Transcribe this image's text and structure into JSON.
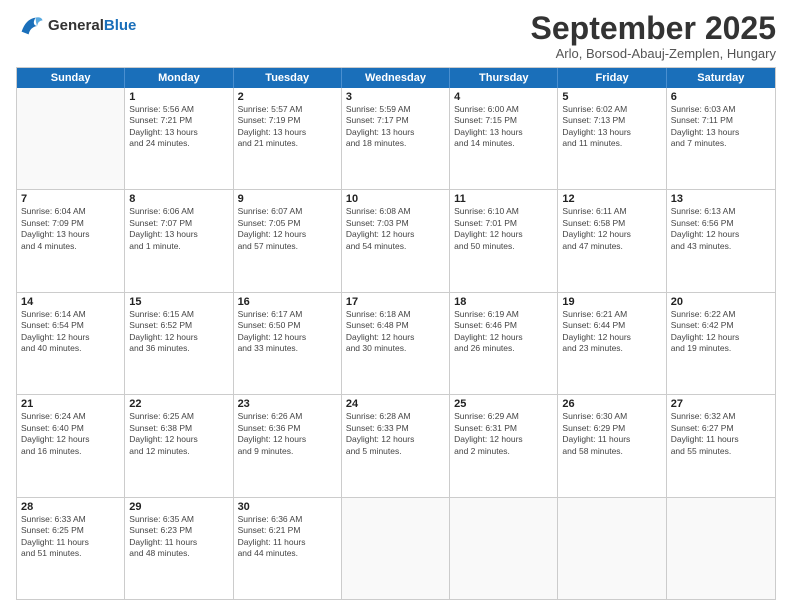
{
  "header": {
    "logo_line1": "General",
    "logo_line2": "Blue",
    "month": "September 2025",
    "location": "Arlo, Borsod-Abauj-Zemplen, Hungary"
  },
  "days_of_week": [
    "Sunday",
    "Monday",
    "Tuesday",
    "Wednesday",
    "Thursday",
    "Friday",
    "Saturday"
  ],
  "weeks": [
    [
      {
        "day": "",
        "info": ""
      },
      {
        "day": "1",
        "info": "Sunrise: 5:56 AM\nSunset: 7:21 PM\nDaylight: 13 hours\nand 24 minutes."
      },
      {
        "day": "2",
        "info": "Sunrise: 5:57 AM\nSunset: 7:19 PM\nDaylight: 13 hours\nand 21 minutes."
      },
      {
        "day": "3",
        "info": "Sunrise: 5:59 AM\nSunset: 7:17 PM\nDaylight: 13 hours\nand 18 minutes."
      },
      {
        "day": "4",
        "info": "Sunrise: 6:00 AM\nSunset: 7:15 PM\nDaylight: 13 hours\nand 14 minutes."
      },
      {
        "day": "5",
        "info": "Sunrise: 6:02 AM\nSunset: 7:13 PM\nDaylight: 13 hours\nand 11 minutes."
      },
      {
        "day": "6",
        "info": "Sunrise: 6:03 AM\nSunset: 7:11 PM\nDaylight: 13 hours\nand 7 minutes."
      }
    ],
    [
      {
        "day": "7",
        "info": "Sunrise: 6:04 AM\nSunset: 7:09 PM\nDaylight: 13 hours\nand 4 minutes."
      },
      {
        "day": "8",
        "info": "Sunrise: 6:06 AM\nSunset: 7:07 PM\nDaylight: 13 hours\nand 1 minute."
      },
      {
        "day": "9",
        "info": "Sunrise: 6:07 AM\nSunset: 7:05 PM\nDaylight: 12 hours\nand 57 minutes."
      },
      {
        "day": "10",
        "info": "Sunrise: 6:08 AM\nSunset: 7:03 PM\nDaylight: 12 hours\nand 54 minutes."
      },
      {
        "day": "11",
        "info": "Sunrise: 6:10 AM\nSunset: 7:01 PM\nDaylight: 12 hours\nand 50 minutes."
      },
      {
        "day": "12",
        "info": "Sunrise: 6:11 AM\nSunset: 6:58 PM\nDaylight: 12 hours\nand 47 minutes."
      },
      {
        "day": "13",
        "info": "Sunrise: 6:13 AM\nSunset: 6:56 PM\nDaylight: 12 hours\nand 43 minutes."
      }
    ],
    [
      {
        "day": "14",
        "info": "Sunrise: 6:14 AM\nSunset: 6:54 PM\nDaylight: 12 hours\nand 40 minutes."
      },
      {
        "day": "15",
        "info": "Sunrise: 6:15 AM\nSunset: 6:52 PM\nDaylight: 12 hours\nand 36 minutes."
      },
      {
        "day": "16",
        "info": "Sunrise: 6:17 AM\nSunset: 6:50 PM\nDaylight: 12 hours\nand 33 minutes."
      },
      {
        "day": "17",
        "info": "Sunrise: 6:18 AM\nSunset: 6:48 PM\nDaylight: 12 hours\nand 30 minutes."
      },
      {
        "day": "18",
        "info": "Sunrise: 6:19 AM\nSunset: 6:46 PM\nDaylight: 12 hours\nand 26 minutes."
      },
      {
        "day": "19",
        "info": "Sunrise: 6:21 AM\nSunset: 6:44 PM\nDaylight: 12 hours\nand 23 minutes."
      },
      {
        "day": "20",
        "info": "Sunrise: 6:22 AM\nSunset: 6:42 PM\nDaylight: 12 hours\nand 19 minutes."
      }
    ],
    [
      {
        "day": "21",
        "info": "Sunrise: 6:24 AM\nSunset: 6:40 PM\nDaylight: 12 hours\nand 16 minutes."
      },
      {
        "day": "22",
        "info": "Sunrise: 6:25 AM\nSunset: 6:38 PM\nDaylight: 12 hours\nand 12 minutes."
      },
      {
        "day": "23",
        "info": "Sunrise: 6:26 AM\nSunset: 6:36 PM\nDaylight: 12 hours\nand 9 minutes."
      },
      {
        "day": "24",
        "info": "Sunrise: 6:28 AM\nSunset: 6:33 PM\nDaylight: 12 hours\nand 5 minutes."
      },
      {
        "day": "25",
        "info": "Sunrise: 6:29 AM\nSunset: 6:31 PM\nDaylight: 12 hours\nand 2 minutes."
      },
      {
        "day": "26",
        "info": "Sunrise: 6:30 AM\nSunset: 6:29 PM\nDaylight: 11 hours\nand 58 minutes."
      },
      {
        "day": "27",
        "info": "Sunrise: 6:32 AM\nSunset: 6:27 PM\nDaylight: 11 hours\nand 55 minutes."
      }
    ],
    [
      {
        "day": "28",
        "info": "Sunrise: 6:33 AM\nSunset: 6:25 PM\nDaylight: 11 hours\nand 51 minutes."
      },
      {
        "day": "29",
        "info": "Sunrise: 6:35 AM\nSunset: 6:23 PM\nDaylight: 11 hours\nand 48 minutes."
      },
      {
        "day": "30",
        "info": "Sunrise: 6:36 AM\nSunset: 6:21 PM\nDaylight: 11 hours\nand 44 minutes."
      },
      {
        "day": "",
        "info": ""
      },
      {
        "day": "",
        "info": ""
      },
      {
        "day": "",
        "info": ""
      },
      {
        "day": "",
        "info": ""
      }
    ]
  ]
}
